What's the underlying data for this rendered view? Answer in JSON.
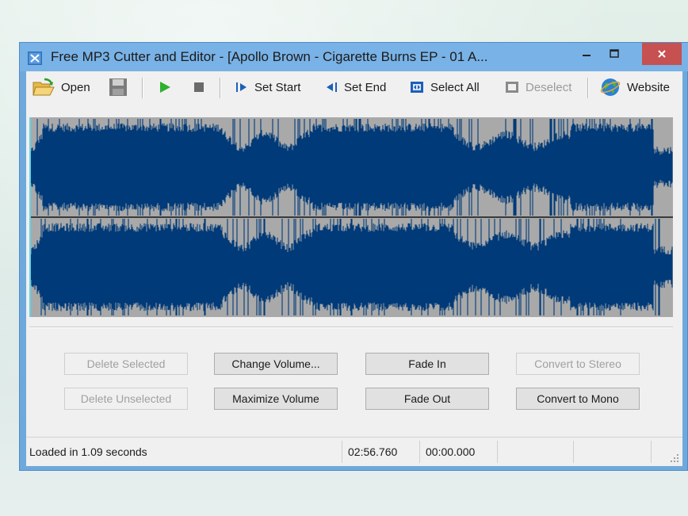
{
  "window": {
    "title": "Free MP3 Cutter and Editor - [Apollo Brown - Cigarette Burns EP - 01 A...",
    "controls": [
      "minimize",
      "maximize",
      "close"
    ]
  },
  "toolbar": {
    "open_label": "Open",
    "save_icon": "save-icon",
    "play_icon": "play-icon",
    "stop_icon": "stop-icon",
    "set_start_label": "Set Start",
    "set_end_label": "Set End",
    "select_all_label": "Select All",
    "deselect_label": "Deselect",
    "website_label": "Website"
  },
  "waveform": {
    "channels": 2,
    "wave_color": "#003a78",
    "background_color": "#a9a9a9",
    "cursor_color": "#63d3e6"
  },
  "buttons": {
    "delete_selected": "Delete Selected",
    "delete_unselected": "Delete Unselected",
    "change_volume": "Change Volume...",
    "maximize_volume": "Maximize Volume",
    "fade_in": "Fade In",
    "fade_out": "Fade Out",
    "convert_to_stereo": "Convert to Stereo",
    "convert_to_mono": "Convert to Mono"
  },
  "status": {
    "message": "Loaded in 1.09 seconds",
    "duration": "02:56.760",
    "position": "00:00.000"
  },
  "colors": {
    "title_bar": "#79b2e6",
    "close_button": "#c75050",
    "client_bg": "#f0f0f0"
  }
}
